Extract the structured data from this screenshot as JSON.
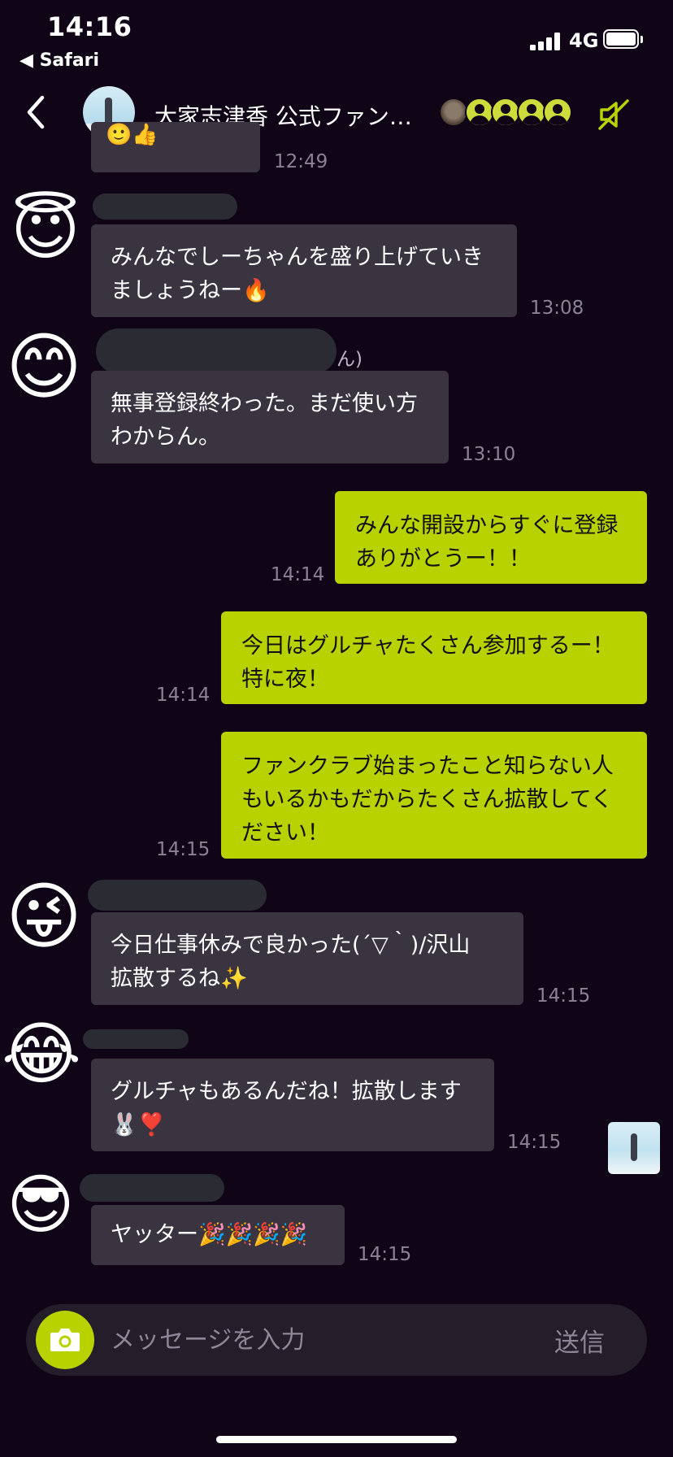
{
  "status_bar": {
    "time": "14:16",
    "back_app": "◀ Safari",
    "network": "4G"
  },
  "header": {
    "title": "大家志津香 公式ファン…"
  },
  "messages": [
    {
      "kind": "partial",
      "time": "12:49"
    },
    {
      "kind": "in",
      "avatar": "smiling-face-with-halo-emoji",
      "text": "みんなでしーちゃんを盛り上げていき\nましょうねー🔥",
      "time": "13:08"
    },
    {
      "kind": "in",
      "avatar": "smiling-face-with-smiling-eyes-emoji",
      "name_tail": "ん)",
      "text": "無事登録終わった。まだ使い方\nわからん。",
      "time": "13:10"
    },
    {
      "kind": "out",
      "text": "みんな開設からすぐに登録\nありがとうー！！",
      "time": "14:14"
    },
    {
      "kind": "out",
      "text": "今日はグルチャたくさん参加するー！\n特に夜！",
      "time": "14:14"
    },
    {
      "kind": "out",
      "text": "ファンクラブ始まったこと知らない人\nもいるかもだからたくさん拡散してく\nださい！",
      "time": "14:15"
    },
    {
      "kind": "in",
      "avatar": "winking-face-with-tongue-emoji",
      "text": "今日仕事休みで良かった(´▽｀)/沢山\n拡散するね✨",
      "time": "14:15"
    },
    {
      "kind": "in",
      "avatar": "face-with-tears-of-joy-emoji",
      "text": "グルチャもあるんだね！拡散します\n🐰❣️",
      "time": "14:15"
    },
    {
      "kind": "in",
      "avatar": "smiling-face-with-sunglasses-emoji",
      "text": "ヤッター🎉🎉🎉🎉",
      "time": "14:15"
    }
  ],
  "input": {
    "placeholder": "メッセージを入力",
    "send_label": "送信"
  },
  "colors": {
    "background": "#0f0517",
    "incoming_bubble": "#3a3441",
    "outgoing_bubble": "#b8d200",
    "accent": "#b8d200",
    "timestamp": "#8a8393"
  }
}
